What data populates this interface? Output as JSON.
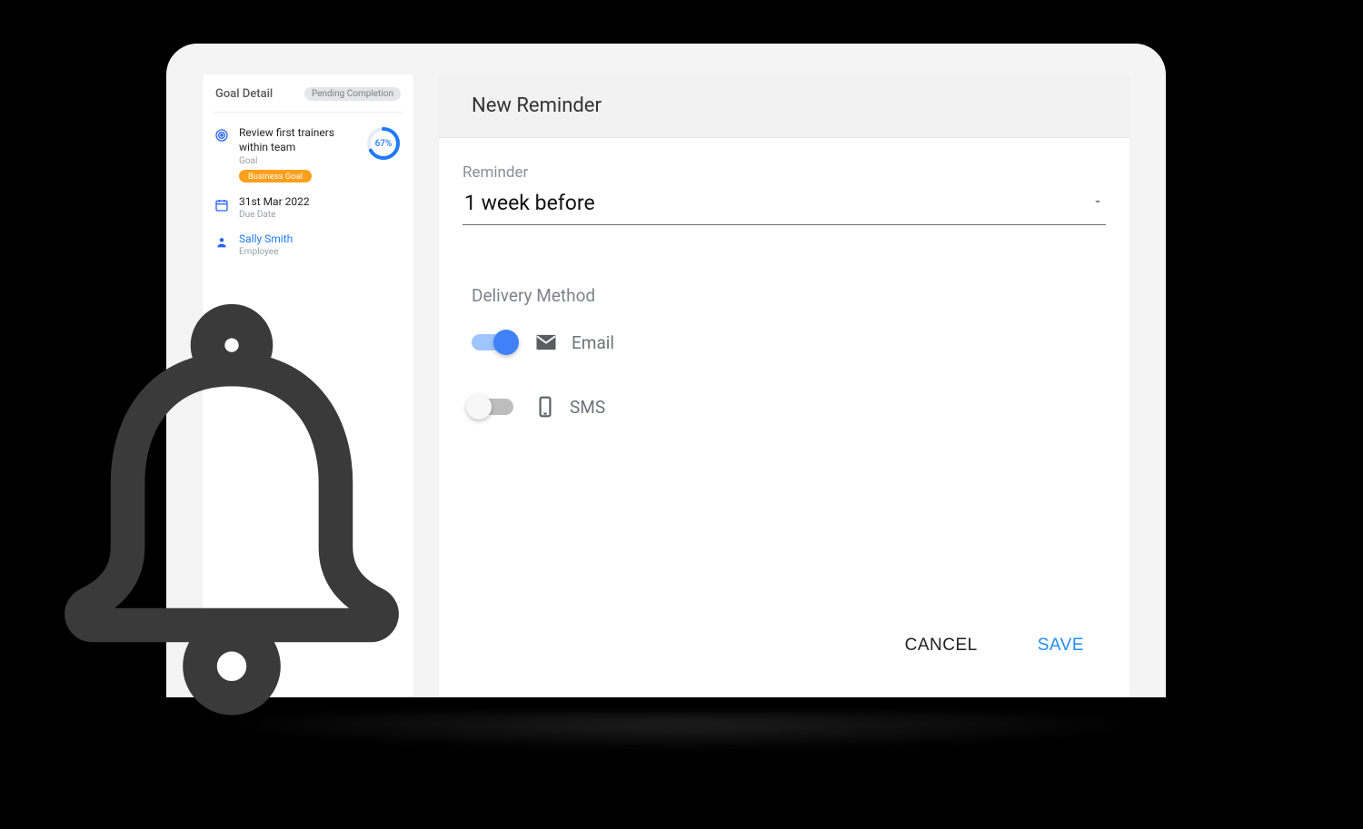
{
  "sidebar": {
    "title": "Goal Detail",
    "status": "Pending Completion",
    "goal": {
      "name": "Review first trainers within team",
      "sublabel": "Goal",
      "chip": "Business Goal",
      "progress_pct": 67,
      "progress_text": "67%"
    },
    "due": {
      "date": "31st Mar 2022",
      "label": "Due Date"
    },
    "employee": {
      "name": "Sally Smith",
      "label": "Employee"
    }
  },
  "main": {
    "title": "New Reminder",
    "reminder_label": "Reminder",
    "reminder_value": "1 week before",
    "delivery_label": "Delivery Method",
    "email_label": "Email",
    "sms_label": "SMS",
    "cancel": "CANCEL",
    "save": "SAVE"
  }
}
